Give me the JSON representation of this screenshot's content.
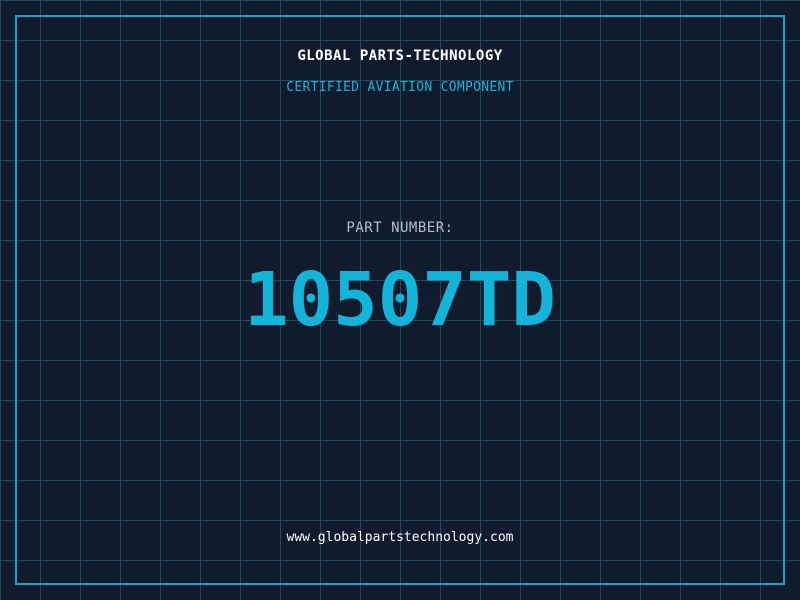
{
  "header": {
    "company_name": "GLOBAL PARTS-TECHNOLOGY",
    "tagline": "CERTIFIED AVIATION COMPONENT"
  },
  "main": {
    "part_label": "PART NUMBER:",
    "part_number": "10507TD"
  },
  "footer": {
    "website": "www.globalpartstechnology.com"
  },
  "colors": {
    "background": "#111b2e",
    "grid": "#1f4a5e",
    "accent": "#12b4d9",
    "frame": "#1aa3c7"
  }
}
